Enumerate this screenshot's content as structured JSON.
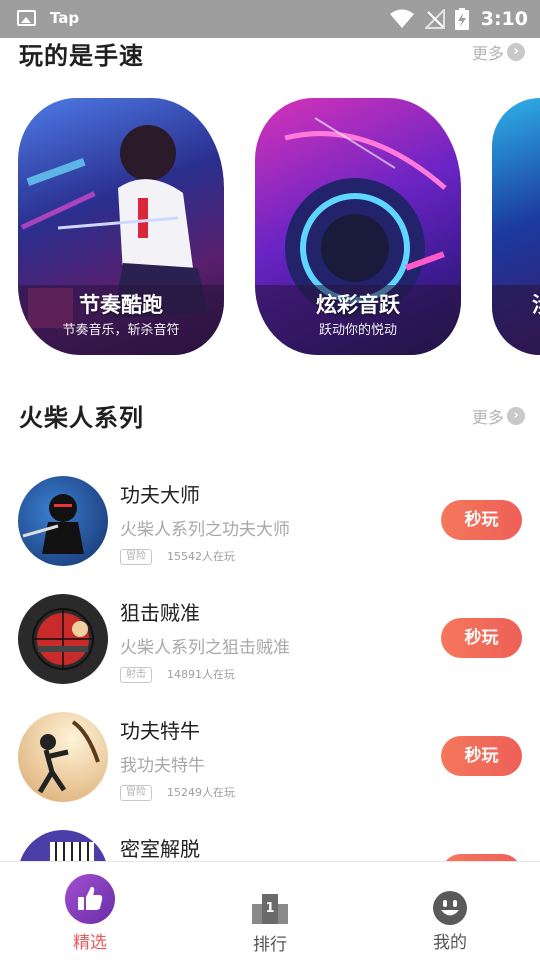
{
  "status_bar": {
    "app_name": "Tap",
    "time": "3:10"
  },
  "sections": {
    "speed": {
      "title": "玩的是手速",
      "more": "更多"
    },
    "stickman": {
      "title": "火柴人系列",
      "more": "更多"
    }
  },
  "cards": [
    {
      "name": "节奏酷跑",
      "subtitle": "节奏音乐，斩杀音符"
    },
    {
      "name": "炫彩音跃",
      "subtitle": "跃动你的悦动"
    },
    {
      "name": "涉"
    }
  ],
  "games": [
    {
      "name": "功夫大师",
      "desc": "火柴人系列之功夫大师",
      "tag": "冒险",
      "players": "15542人在玩",
      "button": "秒玩"
    },
    {
      "name": "狙击贼准",
      "desc": "火柴人系列之狙击贼准",
      "tag": "射击",
      "players": "14891人在玩",
      "button": "秒玩"
    },
    {
      "name": "功夫特牛",
      "desc": "我功夫特牛",
      "tag": "冒险",
      "players": "15249人在玩",
      "button": "秒玩"
    },
    {
      "name": "密室解脱"
    }
  ],
  "bottom_nav": [
    {
      "label": "精选",
      "active": true
    },
    {
      "label": "排行",
      "active": false
    },
    {
      "label": "我的",
      "active": false
    }
  ],
  "colors": {
    "accent": "#ee5f58",
    "button_gradient_start": "#f4785a",
    "nav_active": "#e85a5a",
    "nav_inactive": "#555555",
    "status_bar_bg": "#9e9e9e"
  },
  "icons": {
    "status": [
      "image-icon",
      "wifi-icon",
      "no-signal-icon",
      "battery-charging-icon"
    ],
    "more": "chevron-right-icon",
    "nav": [
      "thumbs-up-icon",
      "rank-podium-icon",
      "smiley-face-icon"
    ]
  }
}
